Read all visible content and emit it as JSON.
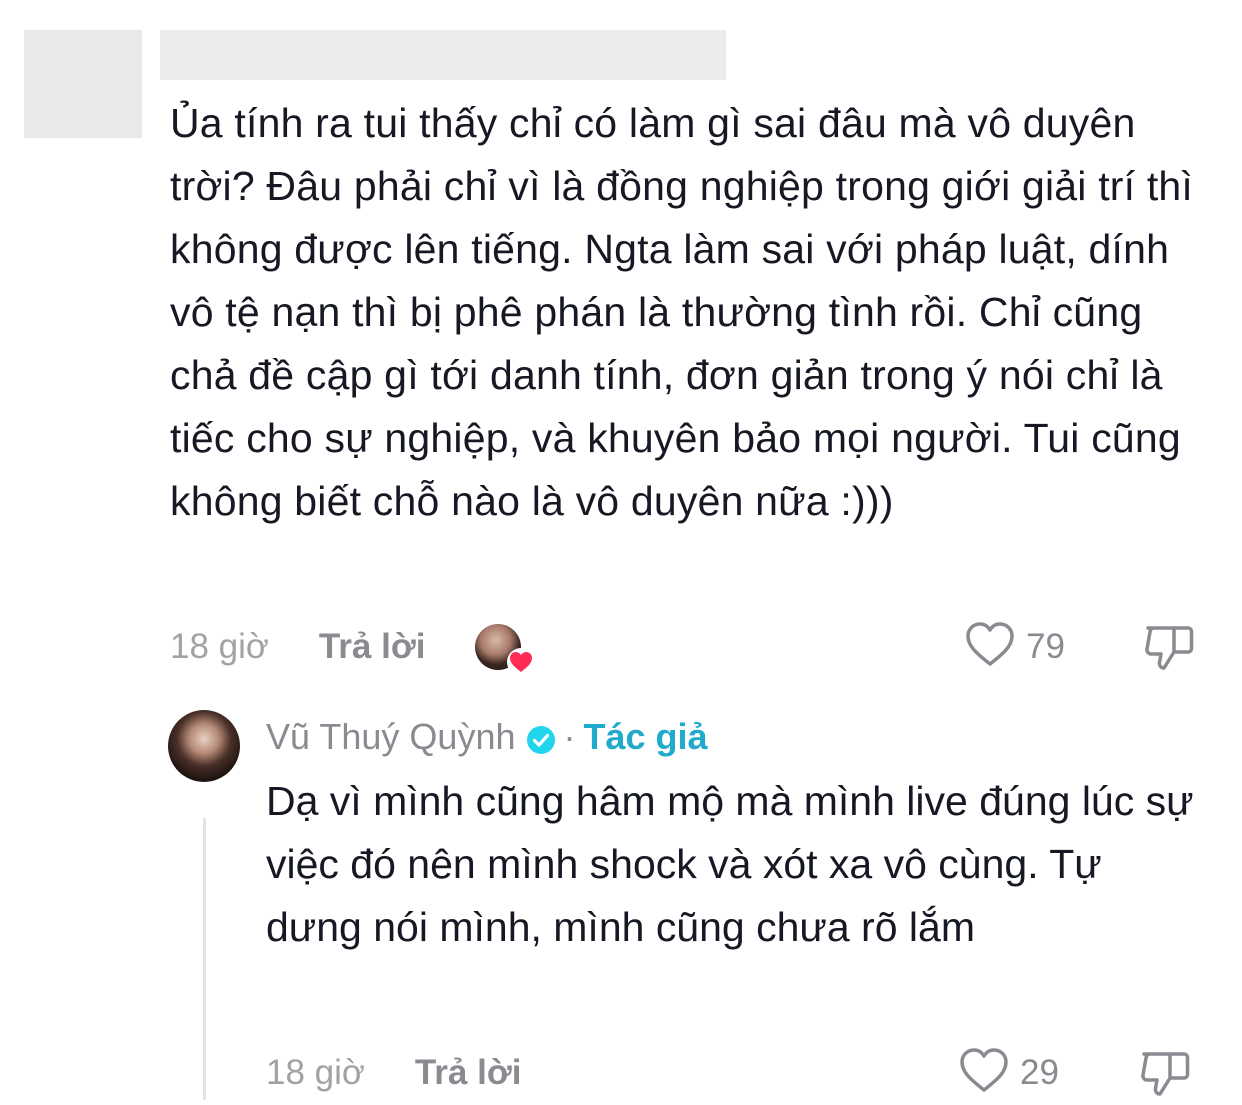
{
  "comment": {
    "text": "Ủa tính ra tui thấy chỉ có làm gì sai đâu mà vô duyên trời? Đâu phải chỉ vì là đồng nghiệp trong giới giải trí thì không được lên tiếng. Ngta làm sai với pháp luật, dính vô tệ nạn thì bị phê phán là thường tình rồi. Chỉ cũng chả đề cập gì tới danh tính, đơn giản trong ý nói chỉ là tiếc cho sự nghiệp, và khuyên bảo mọi người. Tui cũng không biết chỗ nào là vô duyên nữa :)))",
    "time": "18 giờ",
    "reply_label": "Trả lời",
    "like_count": "79",
    "icons": {
      "like": "heart-outline-icon",
      "dislike": "thumbs-down-outline-icon",
      "liked_by_creator": "creator-avatar-heart-badge"
    }
  },
  "reply": {
    "author_name": "Vũ Thuý Quỳnh",
    "separator": "·",
    "author_tag": "Tác giả",
    "text": "Dạ vì mình cũng hâm mộ mà mình live đúng lúc sự việc đó nên mình shock và xót xa vô cùng. Tự dưng nói mình, mình cũng chưa rõ lắm",
    "time": "18 giờ",
    "reply_label": "Trả lời",
    "like_count": "29",
    "icons": {
      "verified": "verified-badge-icon",
      "like": "heart-outline-icon",
      "dislike": "thumbs-down-outline-icon"
    }
  },
  "colors": {
    "text": "#161823",
    "muted": "#8a8b91",
    "time": "#a2a2a6",
    "author_tag": "#20aacb",
    "verified": "#20d5ec",
    "heart_badge": "#fe2c55"
  }
}
